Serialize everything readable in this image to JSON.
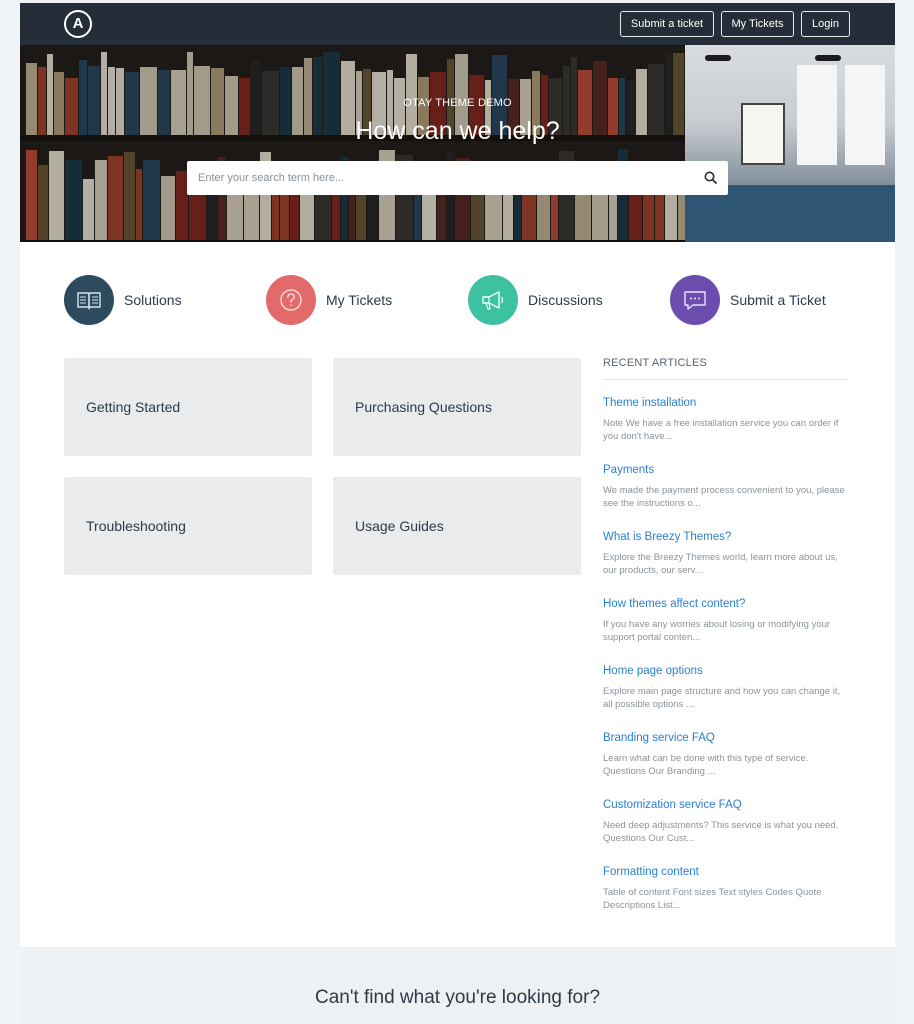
{
  "header": {
    "logo_letter": "A",
    "nav": {
      "submit_ticket": "Submit a ticket",
      "my_tickets": "My Tickets",
      "login": "Login"
    }
  },
  "hero": {
    "kicker": "OTAY THEME DEMO",
    "title": "How can we help?",
    "search_placeholder": "Enter your search term here...",
    "search_icon": "search-icon"
  },
  "shortcuts": [
    {
      "label": "Solutions",
      "icon": "book-icon",
      "color": "#2e4a5e"
    },
    {
      "label": "My Tickets",
      "icon": "question-icon",
      "color": "#e36a6a"
    },
    {
      "label": "Discussions",
      "icon": "megaphone-icon",
      "color": "#3ec1a0"
    },
    {
      "label": "Submit a Ticket",
      "icon": "chat-icon",
      "color": "#6c4cac"
    }
  ],
  "categories": [
    {
      "label": "Getting Started"
    },
    {
      "label": "Purchasing Questions"
    },
    {
      "label": "Troubleshooting"
    },
    {
      "label": "Usage Guides"
    }
  ],
  "recent": {
    "heading": "RECENT ARTICLES",
    "articles": [
      {
        "title": "Theme installation",
        "excerpt": "  Note We have a free installation service you can order if you don't have..."
      },
      {
        "title": "Payments",
        "excerpt": "We made the payment process convenient to you, please see the instructions o..."
      },
      {
        "title": "What is Breezy Themes?",
        "excerpt": "Explore the Breezy Themes world, learn more about us, our products, our serv..."
      },
      {
        "title": "How themes affect content?",
        "excerpt": "If you have any worries about losing or modifying your support portal conten..."
      },
      {
        "title": "Home page options",
        "excerpt": "Explore main page structure and how you can change it, all possible options ..."
      },
      {
        "title": "Branding service FAQ",
        "excerpt": "Learn what can be done with this type of service.  Questions  Our Branding ..."
      },
      {
        "title": "Customization service FAQ",
        "excerpt": "Need deep adjustments? This service is what you need.  Questions Our Cust..."
      },
      {
        "title": "Formatting content",
        "excerpt": "Table of content Font sizes Text styles Codes Quote Descriptions List..."
      }
    ]
  },
  "footer": {
    "text": "Can't find what you're looking for?"
  },
  "colors": {
    "header_bg": "#242d38",
    "link": "#2a7fd0",
    "card_bg": "#e9ebed"
  }
}
